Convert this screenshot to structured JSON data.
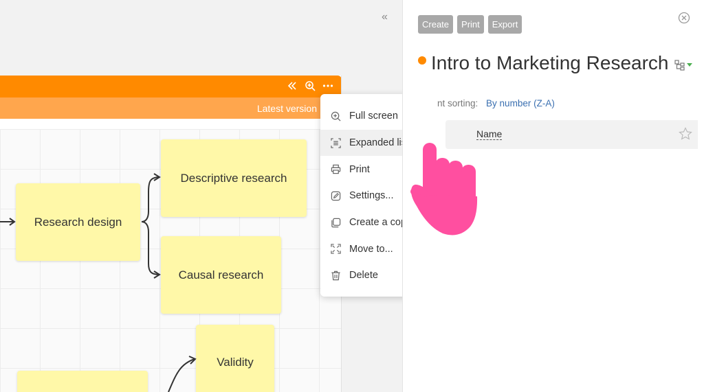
{
  "sidebar_toggle": "«",
  "board": {
    "version_label": "Latest version",
    "header_icons": [
      "collapse-left-icon",
      "zoom-icon",
      "more-icon"
    ]
  },
  "notes": {
    "research_design": "Research design",
    "descriptive_research": "Descriptive research",
    "causal_research": "Causal research",
    "validity": "Validity"
  },
  "context_menu": {
    "items": [
      {
        "label": "Full screen",
        "icon": "zoom-in-icon"
      },
      {
        "label": "Expanded list...",
        "icon": "expanded-list-icon"
      },
      {
        "label": "Print",
        "icon": "print-icon"
      },
      {
        "label": "Settings...",
        "icon": "edit-icon"
      },
      {
        "label": "Create a copy",
        "icon": "copy-icon"
      },
      {
        "label": "Move to...",
        "icon": "move-icon"
      },
      {
        "label": "Delete",
        "icon": "trash-icon"
      }
    ],
    "hovered_index": 1
  },
  "panel": {
    "buttons": {
      "create": "Create",
      "print": "Print",
      "export": "Export"
    },
    "title": "Intro to Marketing Research",
    "status_color": "#ff8a00",
    "sorting_label": "nt sorting:",
    "sorting_value": "By number (Z-A)",
    "column_name": "Name"
  },
  "colors": {
    "accent": "#ff8a00",
    "accent_light": "#ffa64d",
    "note": "#fff8a8",
    "link": "#3a6fb0",
    "cursor_hand": "#ff4fa0"
  }
}
